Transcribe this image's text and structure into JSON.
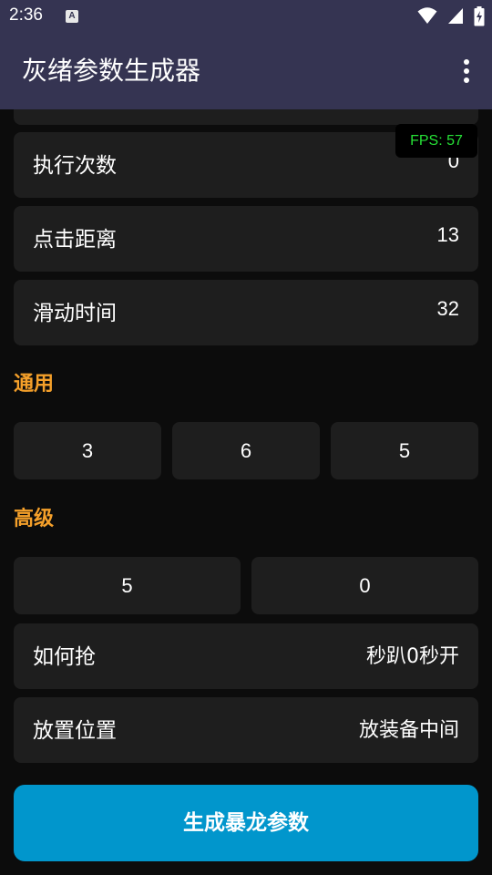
{
  "status_bar": {
    "time": "2:36",
    "notification_glyph": "A",
    "icons": [
      "wifi-icon",
      "signal-icon",
      "battery-charging-icon"
    ]
  },
  "app_bar": {
    "title": "灰绪参数生成器",
    "menu_icon": "more-vert-icon"
  },
  "fps_overlay": "FPS: 57",
  "settings": [
    {
      "label": "",
      "value": ""
    },
    {
      "label": "执行次数",
      "value": "0"
    },
    {
      "label": "点击距离",
      "value": "13"
    },
    {
      "label": "滑动时间",
      "value": "32"
    }
  ],
  "general": {
    "title": "通用",
    "tiles": [
      "3",
      "6",
      "5"
    ]
  },
  "advanced": {
    "title": "高级",
    "tiles": [
      "5",
      "0"
    ],
    "rows": [
      {
        "label": "如何抢",
        "value": "秒趴0秒开"
      },
      {
        "label": "放置位置",
        "value": "放装备中间"
      }
    ]
  },
  "generate_button": "生成暴龙参数",
  "colors": {
    "app_bar": "#353452",
    "background": "#0c0c0c",
    "card": "#1e1e1e",
    "section_title": "#f5a02a",
    "button": "#0196cc",
    "fps_text": "#26e036"
  }
}
